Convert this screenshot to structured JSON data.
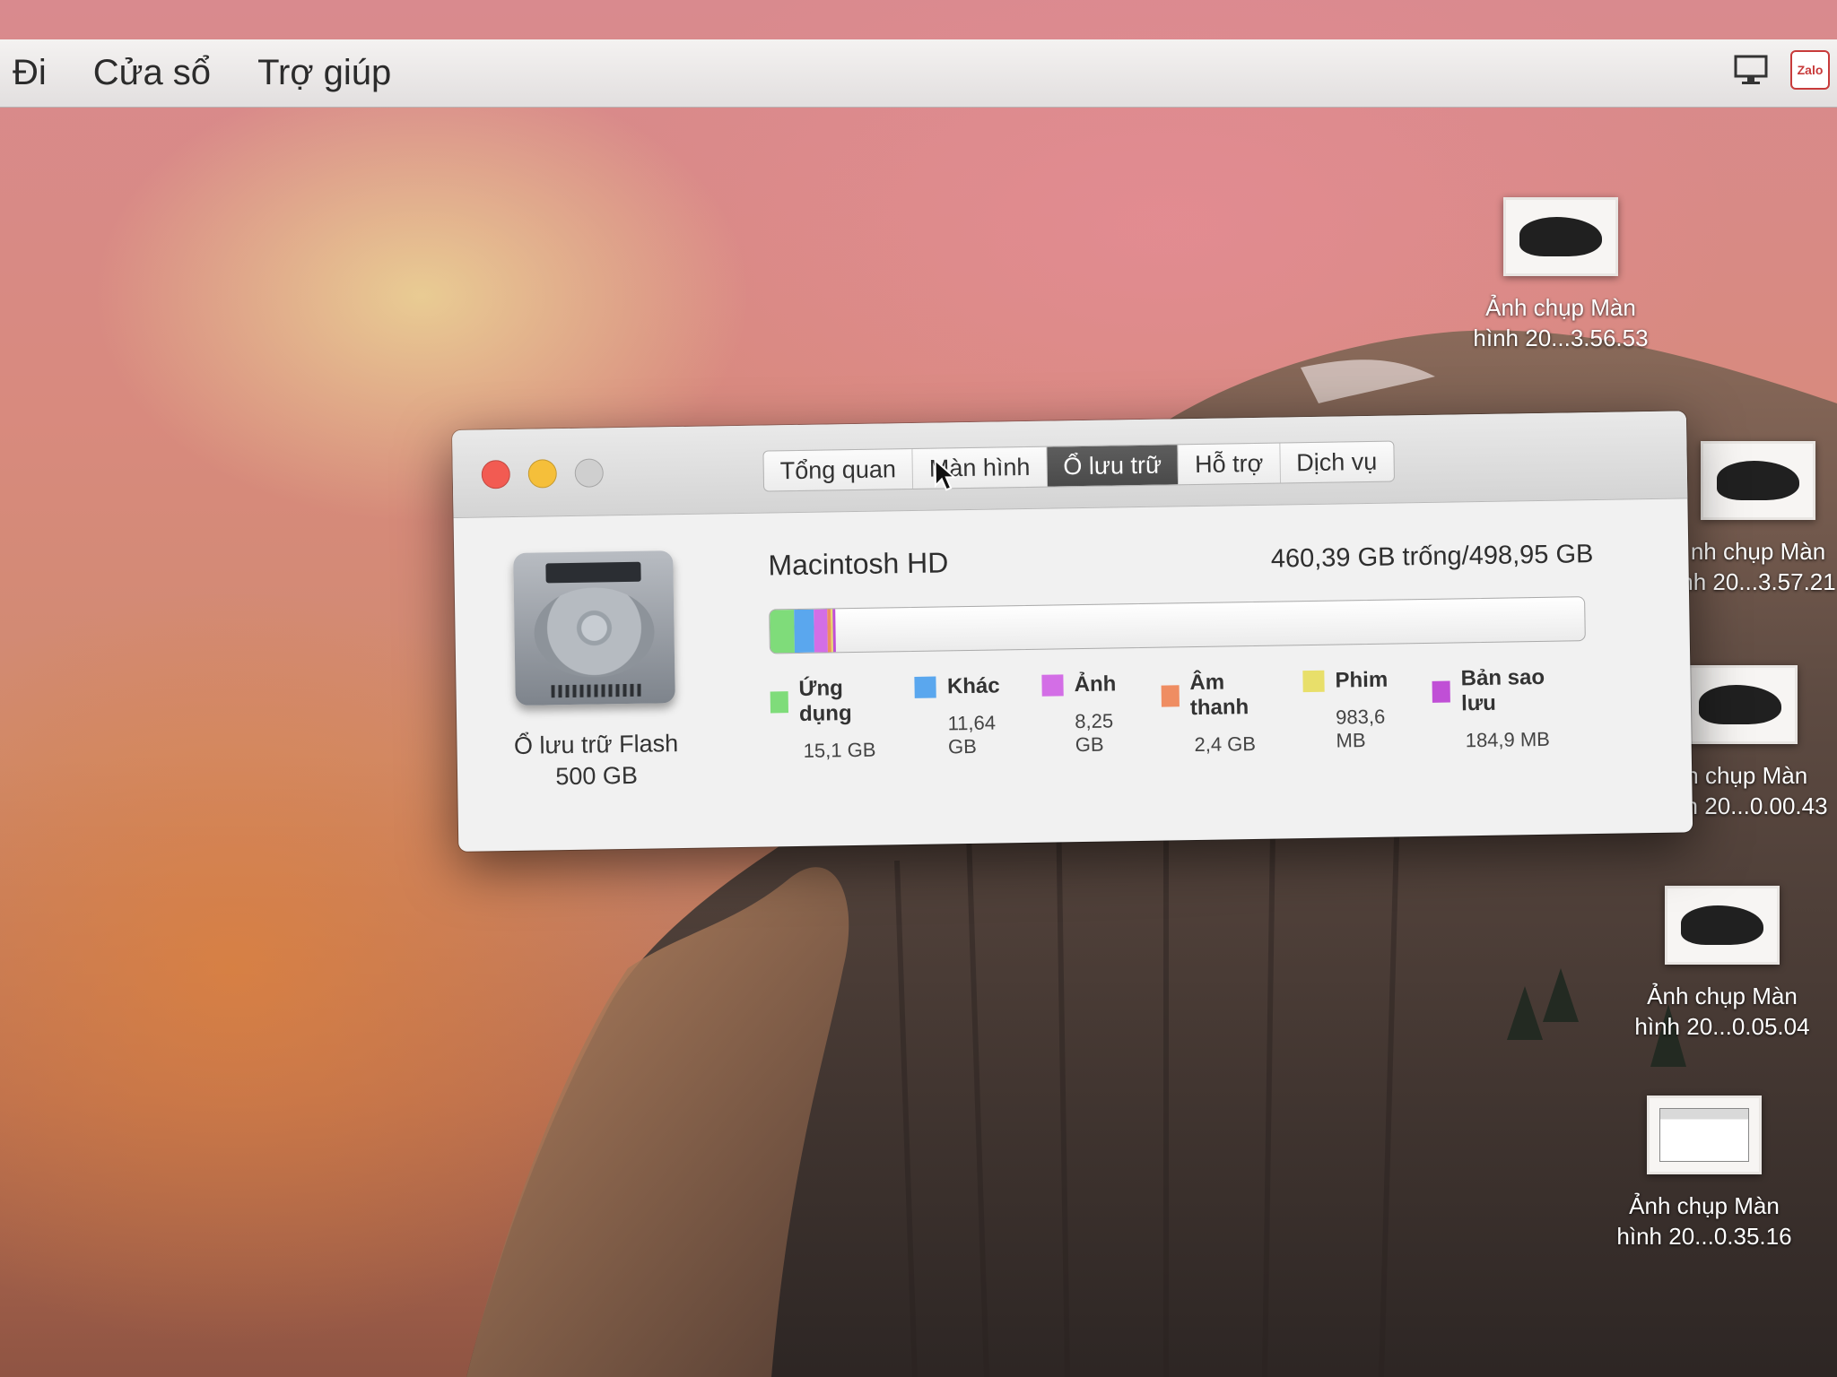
{
  "menubar": {
    "items": [
      "Đi",
      "Cửa sổ",
      "Trợ giúp"
    ],
    "status_icons": [
      "display-icon",
      "zalo-icon"
    ],
    "zalo_text": "Zalo"
  },
  "desktop_icons": [
    {
      "label": "Ảnh chụp Màn\nhình 20...3.56.53",
      "thumb": "shoe"
    },
    {
      "label": "nh chụp Màn\nnh 20...3.57.21",
      "thumb": "shoe"
    },
    {
      "label": "nh chụp Màn\nhình 20...0.00.43",
      "thumb": "shoe"
    },
    {
      "label": "Ảnh chụp Màn\nhình 20...0.05.04",
      "thumb": "shoe"
    },
    {
      "label": "Ảnh chụp Màn\nhình 20...0.35.16",
      "thumb": "screen"
    }
  ],
  "window": {
    "tabs": [
      "Tổng quan",
      "Màn hình",
      "Ổ lưu trữ",
      "Hỗ trợ",
      "Dịch vụ"
    ],
    "active_tab": "Ổ lưu trữ",
    "disk": {
      "name": "Ổ lưu trữ Flash",
      "size": "500 GB"
    },
    "volume": {
      "name": "Macintosh HD",
      "capacity": "460,39 GB trống/498,95 GB",
      "total_gb": 498.95
    },
    "categories": [
      {
        "name": "Ứng dụng",
        "value": "15,1 GB",
        "gb": 15.1,
        "color": "#7fdc7a"
      },
      {
        "name": "Khác",
        "value": "11,64 GB",
        "gb": 11.64,
        "color": "#5aa7ee"
      },
      {
        "name": "Ảnh",
        "value": "8,25 GB",
        "gb": 8.25,
        "color": "#d36ee6"
      },
      {
        "name": "Âm thanh",
        "value": "2,4 GB",
        "gb": 2.4,
        "color": "#ef8d62"
      },
      {
        "name": "Phim",
        "value": "983,6 MB",
        "gb": 0.98,
        "color": "#e8df6a"
      },
      {
        "name": "Bản sao lưu",
        "value": "184,9 MB",
        "gb": 0.18,
        "color": "#c04fd6"
      }
    ]
  }
}
